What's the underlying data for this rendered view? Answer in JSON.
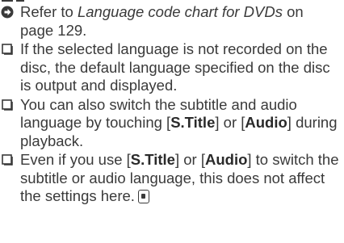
{
  "items": [
    {
      "marker": "arrow-right-icon",
      "prefix": "Refer to ",
      "italic": "Language code chart for DVDs",
      "suffix": " on page 129."
    },
    {
      "marker": "checkbox-icon",
      "text": "If the selected language is not recorded on the disc, the default language specified on the disc is output and displayed."
    },
    {
      "marker": "checkbox-icon",
      "part1": "You can also switch the subtitle and audio language by touching [",
      "bold1": "S.Title",
      "part2": "] or [",
      "bold2": "Audio",
      "part3": "] during playback."
    },
    {
      "marker": "checkbox-icon",
      "part1": "Even if you use [",
      "bold1": "S.Title",
      "part2": "] or [",
      "bold2": "Audio",
      "part3": "] to switch the subtitle or audio language, this does not affect the settings here.",
      "end_icon": "end-of-section-icon"
    }
  ]
}
